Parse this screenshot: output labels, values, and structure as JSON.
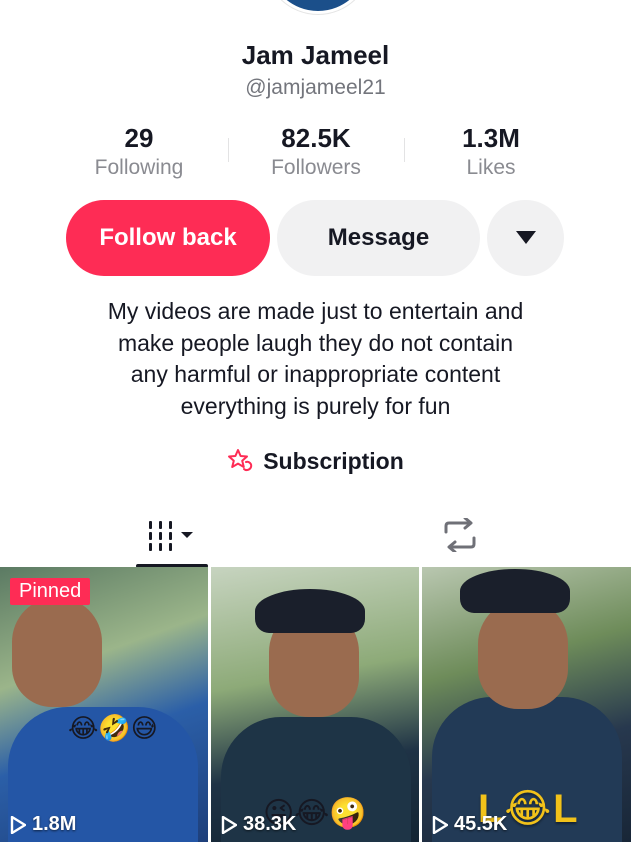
{
  "profile": {
    "display_name": "Jam Jameel",
    "username": "@jamjameel21"
  },
  "stats": [
    {
      "value": "29",
      "label": "Following"
    },
    {
      "value": "82.5K",
      "label": "Followers"
    },
    {
      "value": "1.3M",
      "label": "Likes"
    }
  ],
  "actions": {
    "follow_label": "Follow back",
    "message_label": "Message",
    "more_icon": "caret-down-icon"
  },
  "bio": [
    "My videos are made just to entertain and",
    "make people laugh they do not contain",
    "any harmful or inappropriate content",
    "everything is purely for fun"
  ],
  "subscription": {
    "label": "Subscription",
    "icon": "subscription-star-icon"
  },
  "tabs": [
    {
      "icon": "videos-grid-icon",
      "active": true
    },
    {
      "icon": "repost-icon",
      "active": false
    }
  ],
  "videos": [
    {
      "pinned_label": "Pinned",
      "views": "1.8M",
      "emojis": "😂🤣😅"
    },
    {
      "views": "38.3K",
      "emojis": "😜😂🤪"
    },
    {
      "views": "45.5K",
      "overlay_text": "L😂L"
    }
  ],
  "colors": {
    "accent": "#fe2c55",
    "button_gray": "#f1f1f2",
    "text_primary": "#161823",
    "text_secondary": "#8a8b91"
  }
}
